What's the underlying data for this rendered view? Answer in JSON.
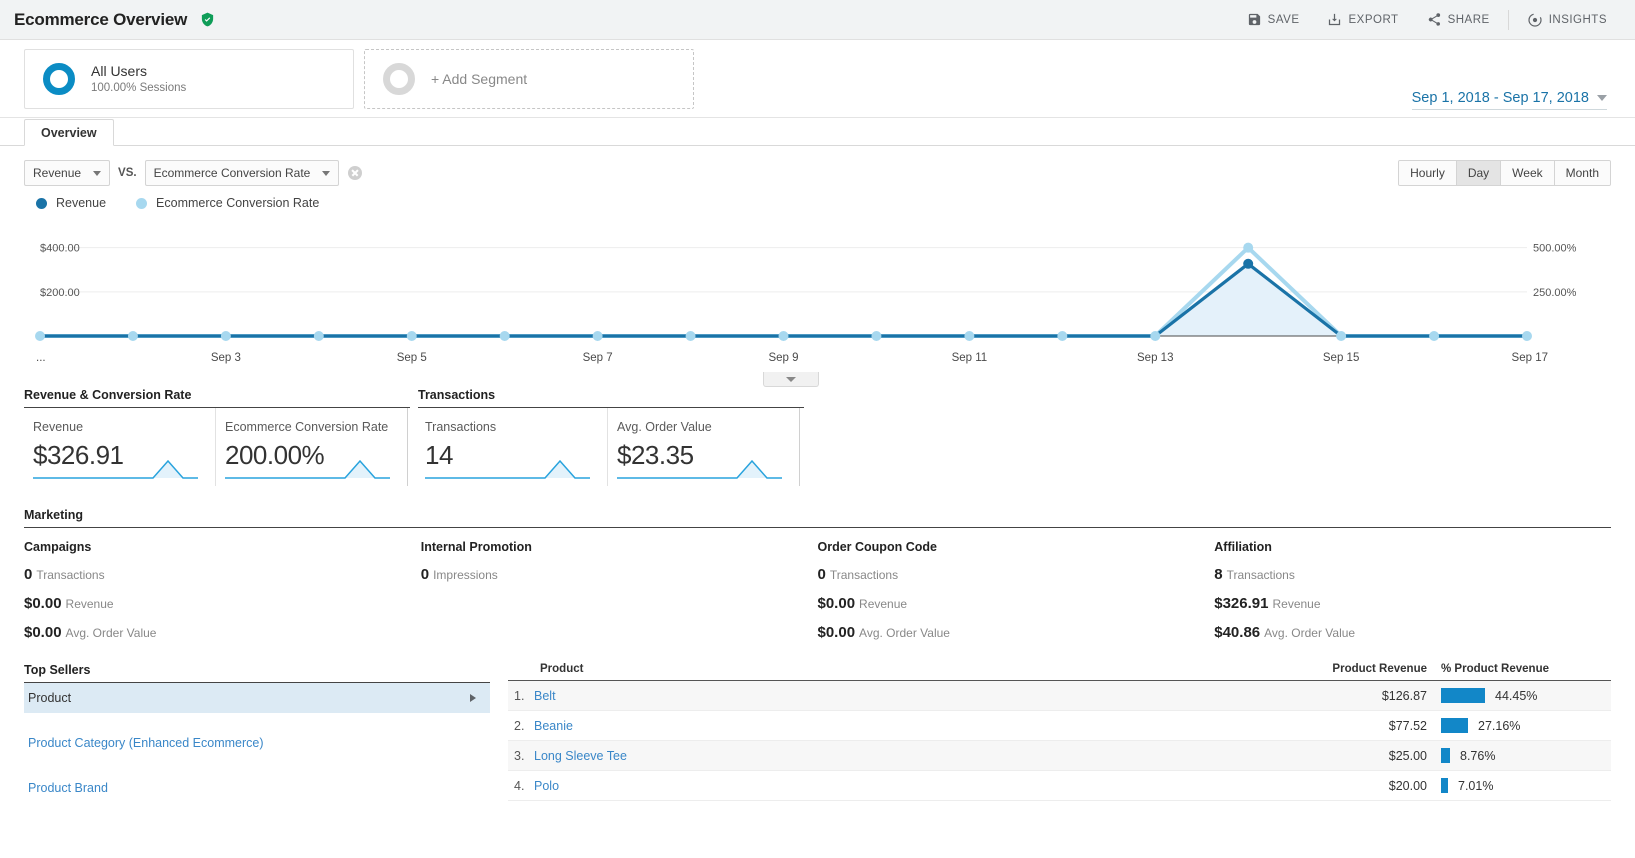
{
  "header": {
    "title": "Ecommerce Overview",
    "verified_icon": "verified-shield-icon",
    "actions": [
      {
        "label": "SAVE",
        "icon": "save-icon"
      },
      {
        "label": "EXPORT",
        "icon": "export-icon"
      },
      {
        "label": "SHARE",
        "icon": "share-icon"
      },
      {
        "label": "INSIGHTS",
        "icon": "insights-icon"
      }
    ]
  },
  "segments": {
    "primary": {
      "name": "All Users",
      "sub": "100.00% Sessions"
    },
    "add_label": "+ Add Segment"
  },
  "date_range": {
    "label": "Sep 1, 2018 - Sep 17, 2018"
  },
  "tabs": [
    {
      "label": "Overview",
      "active": true
    }
  ],
  "chart_controls": {
    "metric_a": "Revenue",
    "vs_label": "VS.",
    "metric_b": "Ecommerce Conversion Rate",
    "remove_icon": "remove-circle-icon",
    "granularity": [
      "Hourly",
      "Day",
      "Week",
      "Month"
    ],
    "granularity_active": "Day"
  },
  "legend": [
    {
      "label": "Revenue",
      "color": "#1a73a7"
    },
    {
      "label": "Ecommerce Conversion Rate",
      "color": "#a7d8ef"
    }
  ],
  "chart_data": {
    "type": "line",
    "title": "",
    "xlabel": "",
    "ylabel": "Revenue",
    "grid": true,
    "legend_position": "top-left",
    "x": [
      "...",
      "Sep 2",
      "Sep 3",
      "Sep 4",
      "Sep 5",
      "Sep 6",
      "Sep 7",
      "Sep 8",
      "Sep 9",
      "Sep 10",
      "Sep 11",
      "Sep 12",
      "Sep 13",
      "Sep 14",
      "Sep 15",
      "Sep 16",
      "Sep 17"
    ],
    "x_tick_labels": [
      "...",
      "Sep 3",
      "Sep 5",
      "Sep 7",
      "Sep 9",
      "Sep 11",
      "Sep 13",
      "Sep 15",
      "Sep 17"
    ],
    "left_axis": {
      "ticks": [
        "$400.00",
        "$200.00"
      ],
      "values": [
        400,
        200
      ],
      "ylim": [
        0,
        480
      ]
    },
    "right_axis": {
      "ticks": [
        "500.00%",
        "250.00%"
      ],
      "values": [
        500,
        250
      ],
      "ylim": [
        0,
        600
      ]
    },
    "series": [
      {
        "name": "Revenue",
        "color": "#1a73a7",
        "values": [
          0,
          0,
          0,
          0,
          0,
          0,
          0,
          0,
          0,
          0,
          0,
          0,
          0,
          326.91,
          0,
          0,
          0
        ]
      },
      {
        "name": "Ecommerce Conversion Rate",
        "color": "#a7d8ef",
        "values": [
          0,
          0,
          0,
          0,
          0,
          0,
          0,
          0,
          0,
          0,
          0,
          0,
          0,
          500,
          0,
          0,
          0
        ]
      }
    ]
  },
  "collapse_handle": {
    "icon": "chevron-down-icon"
  },
  "kpi_sections": [
    {
      "title": "Revenue & Conversion Rate",
      "cards": [
        {
          "label": "Revenue",
          "value": "$326.91"
        },
        {
          "label": "Ecommerce Conversion Rate",
          "value": "200.00%"
        }
      ]
    },
    {
      "title": "Transactions",
      "cards": [
        {
          "label": "Transactions",
          "value": "14"
        },
        {
          "label": "Avg. Order Value",
          "value": "$23.35"
        }
      ]
    }
  ],
  "marketing": {
    "title": "Marketing",
    "columns": [
      {
        "title": "Campaigns",
        "lines": [
          {
            "value": "0",
            "label": "Transactions"
          },
          {
            "value": "$0.00",
            "label": "Revenue"
          },
          {
            "value": "$0.00",
            "label": "Avg. Order Value"
          }
        ]
      },
      {
        "title": "Internal Promotion",
        "lines": [
          {
            "value": "0",
            "label": "Impressions"
          }
        ]
      },
      {
        "title": "Order Coupon Code",
        "lines": [
          {
            "value": "0",
            "label": "Transactions"
          },
          {
            "value": "$0.00",
            "label": "Revenue"
          },
          {
            "value": "$0.00",
            "label": "Avg. Order Value"
          }
        ]
      },
      {
        "title": "Affiliation",
        "lines": [
          {
            "value": "8",
            "label": "Transactions"
          },
          {
            "value": "$326.91",
            "label": "Revenue"
          },
          {
            "value": "$40.86",
            "label": "Avg. Order Value"
          }
        ]
      }
    ]
  },
  "top_sellers": {
    "title": "Top Sellers",
    "items": [
      {
        "label": "Product",
        "active": true
      },
      {
        "label": "Product Category (Enhanced Ecommerce)",
        "active": false
      },
      {
        "label": "Product Brand",
        "active": false
      }
    ]
  },
  "product_table": {
    "headers": {
      "name": "Product",
      "revenue": "Product Revenue",
      "pct": "% Product Revenue"
    },
    "rows": [
      {
        "idx": "1.",
        "name": "Belt",
        "revenue": "$126.87",
        "pct": "44.45%",
        "pct_value": 44.45
      },
      {
        "idx": "2.",
        "name": "Beanie",
        "revenue": "$77.52",
        "pct": "27.16%",
        "pct_value": 27.16
      },
      {
        "idx": "3.",
        "name": "Long Sleeve Tee",
        "revenue": "$25.00",
        "pct": "8.76%",
        "pct_value": 8.76
      },
      {
        "idx": "4.",
        "name": "Polo",
        "revenue": "$20.00",
        "pct": "7.01%",
        "pct_value": 7.01
      }
    ]
  },
  "colors": {
    "accent": "#1287c8",
    "accent_light": "#a7d8ef",
    "link": "#3a87c8"
  }
}
